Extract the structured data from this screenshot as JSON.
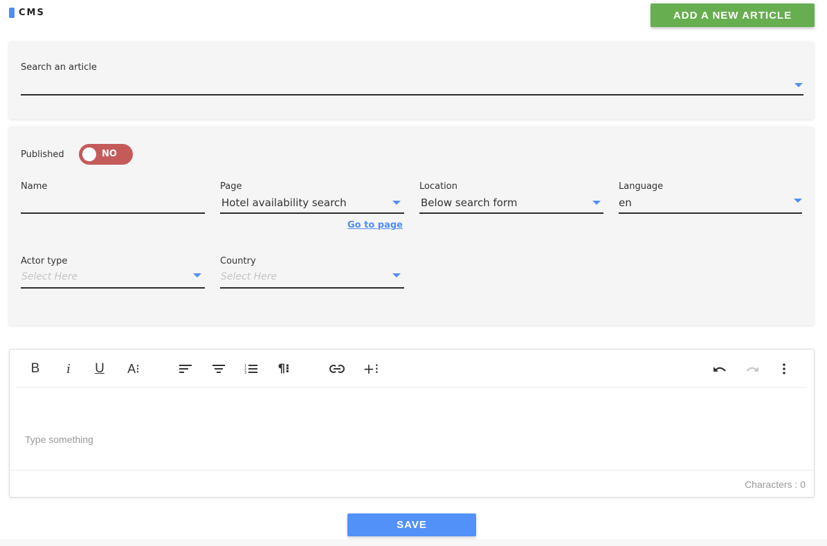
{
  "brand": {
    "title": "CMS",
    "accent": "#4f8ef7"
  },
  "header": {
    "add_button": "ADD A NEW ARTICLE",
    "add_button_color": "#66ae4f"
  },
  "search": {
    "label": "Search an article",
    "value": ""
  },
  "form": {
    "published": {
      "label": "Published",
      "state": "NO",
      "color": "#c55a5a"
    },
    "name": {
      "label": "Name",
      "value": ""
    },
    "page": {
      "label": "Page",
      "value": "Hotel availability search",
      "link": "Go to page"
    },
    "location": {
      "label": "Location",
      "value": "Below search form"
    },
    "language": {
      "label": "Language",
      "value": "en"
    },
    "actor_type": {
      "label": "Actor type",
      "placeholder": "Select Here"
    },
    "country": {
      "label": "Country",
      "placeholder": "Select Here"
    }
  },
  "editor": {
    "toolbar": [
      {
        "name": "bold",
        "glyph": "B"
      },
      {
        "name": "italic",
        "glyph": "i"
      },
      {
        "name": "underline",
        "glyph": "U"
      },
      {
        "name": "font-size",
        "glyph": "A⁝"
      },
      {
        "name": "align-left",
        "glyph": "≡"
      },
      {
        "name": "align-center",
        "glyph": "≡"
      },
      {
        "name": "ordered-list",
        "glyph": "☰"
      },
      {
        "name": "paragraph",
        "glyph": "¶⁝"
      },
      {
        "name": "link",
        "glyph": "⊖"
      },
      {
        "name": "insert",
        "glyph": "+⁝"
      },
      {
        "name": "undo",
        "glyph": "↶"
      },
      {
        "name": "redo",
        "glyph": "↷"
      },
      {
        "name": "more",
        "glyph": "⋮"
      }
    ],
    "placeholder": "Type something",
    "char_count": "Characters : 0"
  },
  "footer": {
    "save_button": "SAVE",
    "save_color": "#5291f7"
  }
}
